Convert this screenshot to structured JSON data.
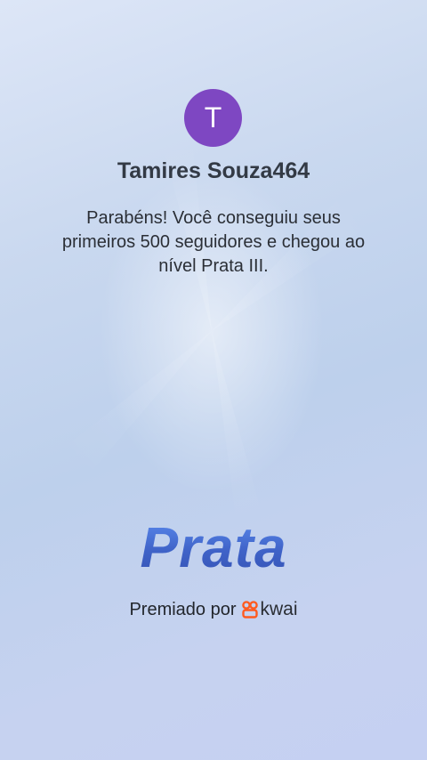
{
  "profile": {
    "avatar_initial": "T",
    "username": "Tamires Souza464"
  },
  "message": {
    "text": "Parabéns! Você conseguiu seus primeiros 500 seguidores e chegou ao nível Prata III."
  },
  "level": {
    "title": "Prata"
  },
  "footer": {
    "awarded_label": "Premiado por",
    "brand_icon": "kwai-logo-icon",
    "brand_name": "kwai"
  },
  "colors": {
    "avatar_bg": "#7e47c2",
    "level_title": "#4a6fd0",
    "brand_icon": "#ff5a1f"
  }
}
